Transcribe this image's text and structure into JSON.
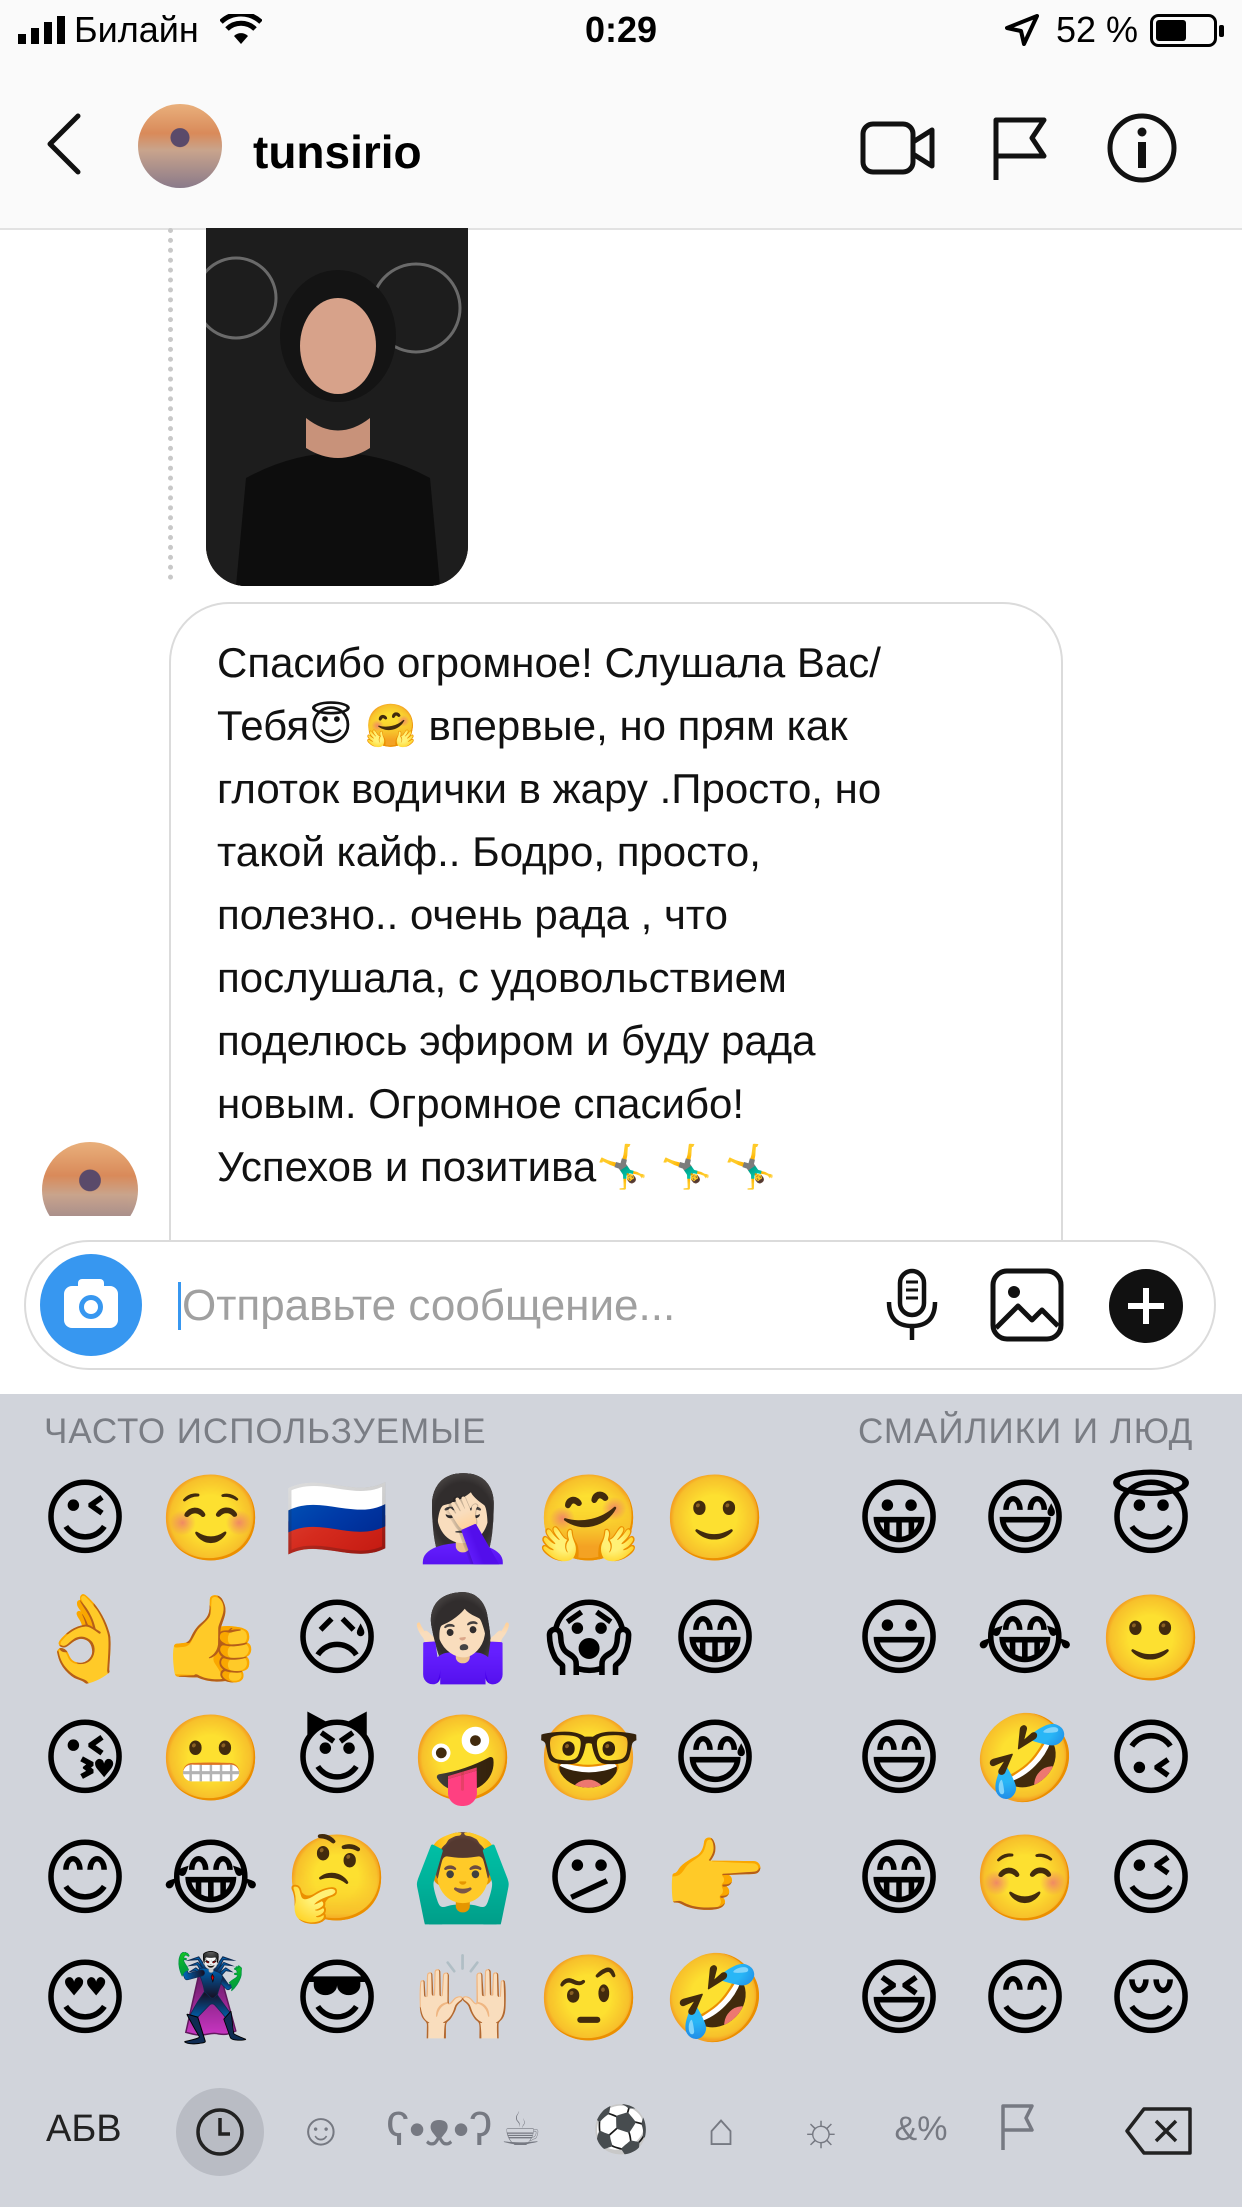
{
  "status_bar": {
    "carrier": "Билайн",
    "time": "0:29",
    "battery_percent": "52 %"
  },
  "header": {
    "username": "tunsirio",
    "icons": [
      "back-chevron-icon",
      "video-call-icon",
      "flag-icon",
      "info-icon"
    ]
  },
  "message": {
    "text": "Спасибо огромное! Слушала Вас/\nТебя😇 🤗 впервые, но прям как\nглоток водички в жару .Просто, но\nтакой кайф.. Бодро, просто,\nполезно.. очень рада , что\nпослушала, с удовольствием\nподелюсь эфиром и буду рада\nновым. Огромное спасибо!\nУспехов и позитива🤸‍♂️ 🤸‍♂️ 🤸‍♂️"
  },
  "composer": {
    "placeholder": "Отправьте сообщение...",
    "value": ""
  },
  "keyboard": {
    "frequently_used_label": "ЧАСТО ИСПОЛЬЗУЕМЫЕ",
    "smileys_label": "СМАЙЛИКИ И ЛЮД",
    "alphabet_key": "АБВ",
    "frequent_columns": [
      [
        "😉",
        "👌",
        "😘",
        "😊",
        "😍"
      ],
      [
        "☺️",
        "👍",
        "😬",
        "😂",
        "🦹‍♂️"
      ],
      [
        "🇷🇺",
        "😥",
        "😈",
        "🤔",
        "😎"
      ],
      [
        "🤦🏻‍♀️",
        "🤷🏻‍♀️",
        "🤪",
        "🙆‍♂️",
        "🙌🏻"
      ],
      [
        "🤗",
        "😱",
        "🤓",
        "😕",
        "🤨"
      ],
      [
        "🙂",
        "😁",
        "😅",
        "👉",
        "🤣"
      ]
    ],
    "smiley_columns": [
      [
        "😀",
        "😃",
        "😄",
        "😁",
        "😆"
      ],
      [
        "😅",
        "😂",
        "🤣",
        "☺️",
        "😊"
      ],
      [
        "😇",
        "🙂",
        "🙃",
        "😉",
        "😌"
      ]
    ],
    "categories": [
      "recent-icon",
      "smiley-icon",
      "animal-icon",
      "food-icon",
      "ball-icon",
      "car-icon",
      "bulb-icon",
      "symbols-icon",
      "flag-icon"
    ]
  }
}
